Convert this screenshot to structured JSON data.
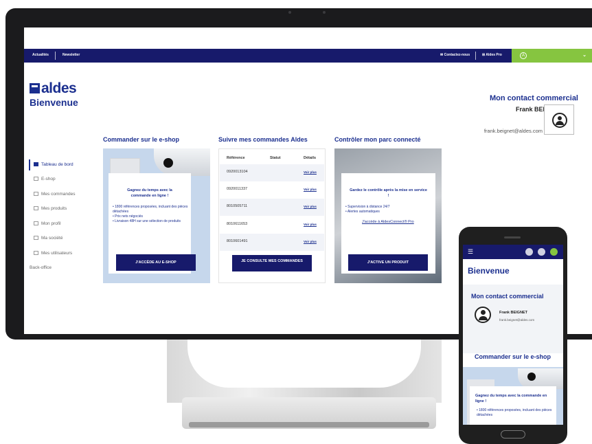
{
  "desktop": {
    "nav": {
      "actualites": "Actualités",
      "newsletter": "Newsletter",
      "contact": "Contactez-nous",
      "pro": "Aldes Pro",
      "account_initial": "A"
    },
    "logo": "aldes",
    "welcome": "Bienvenue",
    "contact": {
      "title": "Mon contact commercial",
      "name": "Frank BEIGNET",
      "email": "frank.beignet@aldes.com"
    },
    "sidebar": [
      {
        "label": "Tableau de bord"
      },
      {
        "label": "E-shop"
      },
      {
        "label": "Mes commandes"
      },
      {
        "label": "Mes produits"
      },
      {
        "label": "Mon profil"
      },
      {
        "label": "Ma société"
      },
      {
        "label": "Mes utilisateurs"
      },
      {
        "label": "Back-office"
      }
    ],
    "eshop": {
      "title": "Commander sur le e-shop",
      "headline": "Gagnez du temps avec la commande en ligne !",
      "bullets": [
        "1800 références proposées, incluant des pièces détachées",
        "Prix nets négociés",
        "Livraison 48H sur une sélection de produits"
      ],
      "button": "J'accède au e-shop"
    },
    "orders": {
      "title": "Suivre mes commandes Aldes",
      "headers": [
        "Référence",
        "Statut",
        "Détails"
      ],
      "rows": [
        {
          "ref": "0920013104",
          "link": "Voir plus"
        },
        {
          "ref": "0920011337",
          "link": "Voir plus"
        },
        {
          "ref": "8010505711",
          "link": "Voir plus"
        },
        {
          "ref": "8010611653",
          "link": "Voir plus"
        },
        {
          "ref": "8010601491",
          "link": "Voir plus"
        }
      ],
      "button": "Je consulte mes commandes"
    },
    "connected": {
      "title": "Contrôler mon parc connecté",
      "headline": "Gardez le contrôle après la mise en service !",
      "bullets": [
        "Supervision à distance 24/7",
        "Alertes automatiques"
      ],
      "link": "J'accède à AldesConnect® Pro",
      "button": "J'active un produit"
    }
  },
  "mobile": {
    "welcome": "Bienvenue",
    "contact_title": "Mon contact commercial",
    "contact_name": "Frank BEIGNET",
    "contact_email": "frank.beignet@aldes.com",
    "shop_title": "Commander sur le e-shop",
    "shop_headline": "Gagnez du temps avec la commande en ligne !",
    "shop_bullet": "1800 références proposées, incluant des pièces détachées"
  },
  "colors": {
    "primary": "#171a6b",
    "accent": "#86c540",
    "card_bg": "#c6d7ec"
  }
}
